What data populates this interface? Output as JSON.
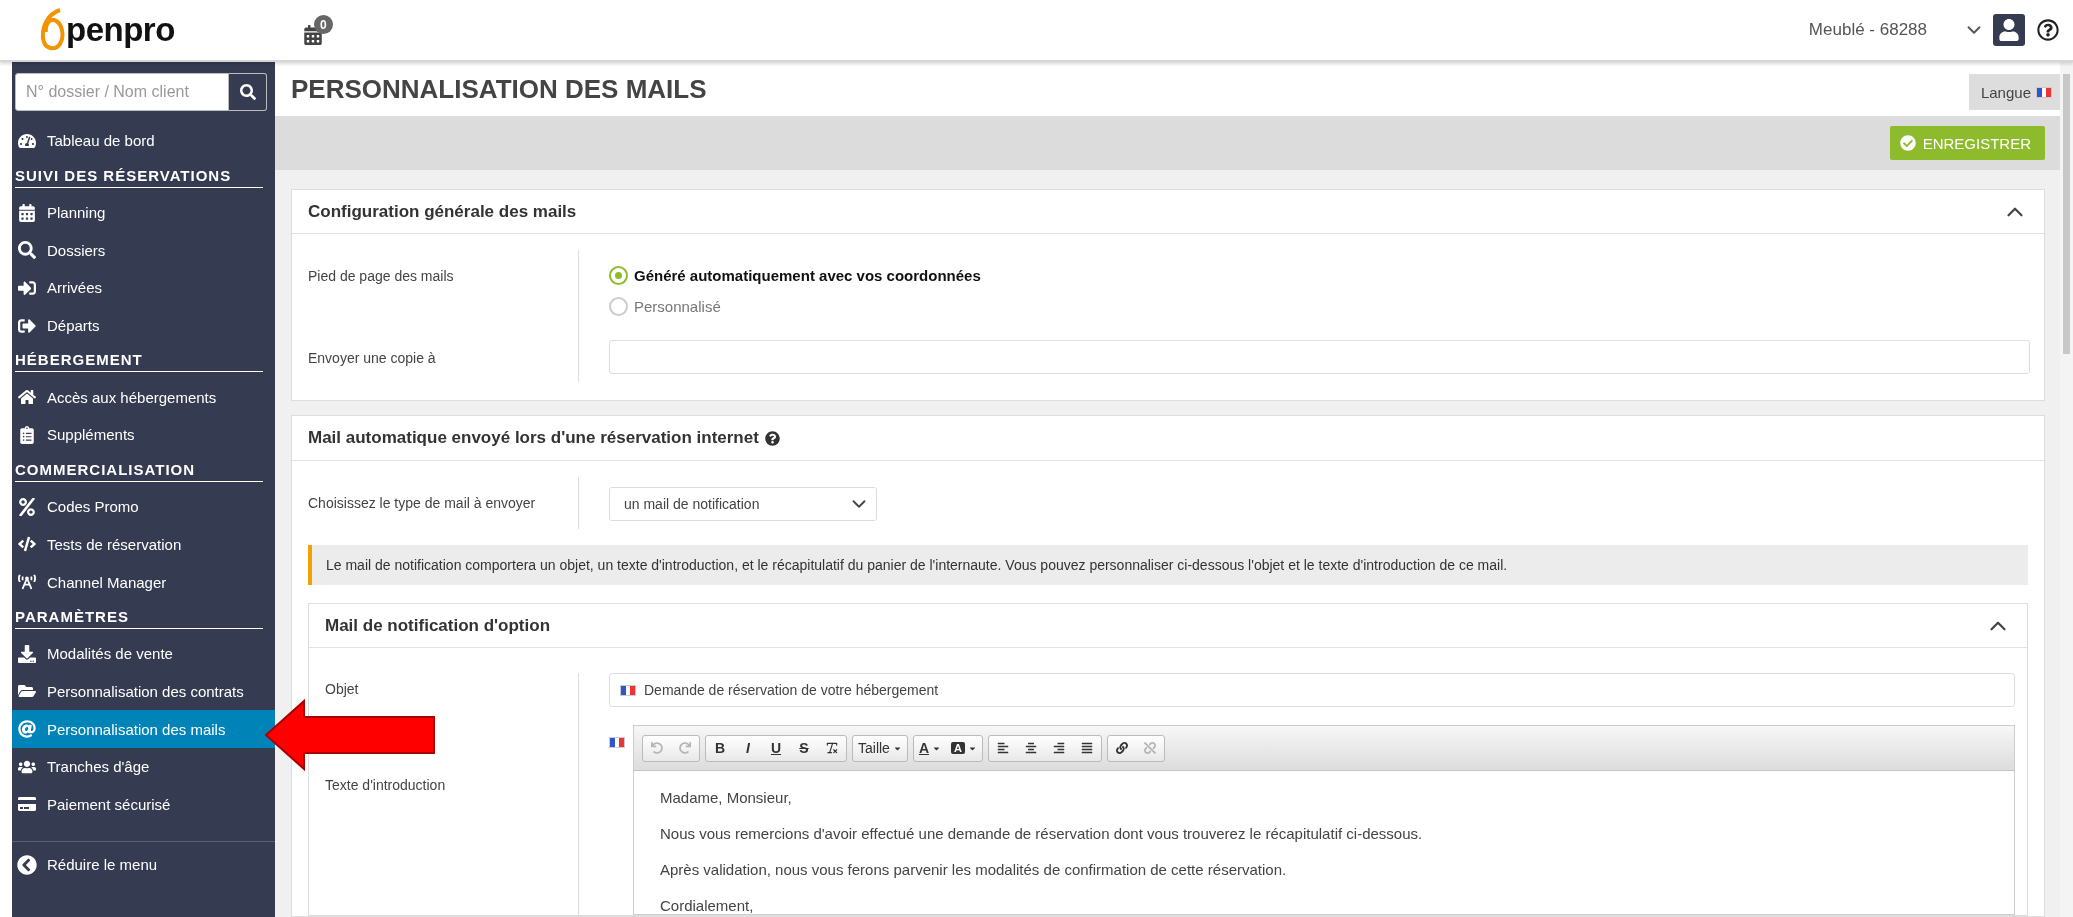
{
  "header": {
    "logo_text": "penpro",
    "notifications": "0",
    "account": "Meublé - 68288"
  },
  "sidebar": {
    "search": {
      "placeholder": "N° dossier / Nom client"
    },
    "items": [
      {
        "kind": "link",
        "label": "Tableau de bord",
        "selected": false
      },
      {
        "kind": "heading",
        "label": "SUIVI DES RÉSERVATIONS"
      },
      {
        "kind": "link",
        "label": "Planning",
        "selected": false
      },
      {
        "kind": "link",
        "label": "Dossiers",
        "selected": false
      },
      {
        "kind": "link",
        "label": "Arrivées",
        "selected": false
      },
      {
        "kind": "link",
        "label": "Départs",
        "selected": false
      },
      {
        "kind": "heading",
        "label": "HÉBERGEMENT"
      },
      {
        "kind": "link",
        "label": "Accès aux hébergements",
        "selected": false
      },
      {
        "kind": "link",
        "label": "Suppléments",
        "selected": false
      },
      {
        "kind": "heading",
        "label": "COMMERCIALISATION"
      },
      {
        "kind": "link",
        "label": "Codes Promo",
        "selected": false
      },
      {
        "kind": "link",
        "label": "Tests de réservation",
        "selected": false
      },
      {
        "kind": "link",
        "label": "Channel Manager",
        "selected": false
      },
      {
        "kind": "heading",
        "label": "PARAMÈTRES"
      },
      {
        "kind": "link",
        "label": "Modalités de vente",
        "selected": false
      },
      {
        "kind": "link",
        "label": "Personnalisation des contrats",
        "selected": false
      },
      {
        "kind": "link",
        "label": "Personnalisation des mails",
        "selected": true
      },
      {
        "kind": "link",
        "label": "Tranches d'âge",
        "selected": false
      },
      {
        "kind": "link",
        "label": "Paiement sécurisé",
        "selected": false
      }
    ],
    "collapse": "Réduire le menu"
  },
  "page": {
    "title": "PERSONNALISATION DES MAILS",
    "language_button": "Langue",
    "save_button": "ENREGISTRER"
  },
  "general_config": {
    "title": "Configuration générale des mails",
    "expanded": true,
    "footer": {
      "label": "Pied de page des mails",
      "options": [
        {
          "label": "Généré automatiquement avec vos coordonnées",
          "selected": true
        },
        {
          "label": "Personnalisé",
          "selected": false
        }
      ]
    },
    "copy": {
      "label": "Envoyer une copie à"
    }
  },
  "auto_mail": {
    "title": "Mail automatique envoyé lors d'une réservation internet",
    "type": {
      "label": "Choisissez le type de mail à envoyer",
      "value": "un mail de notification"
    },
    "notice": "Le mail de notification comportera un objet, un texte d'introduction, et le récapitulatif du panier de l'internaute. Vous pouvez personnaliser ci-dessous l'objet et le texte d'introduction de ce mail.",
    "notification": {
      "title": "Mail de notification d'option",
      "expanded": true,
      "subject": {
        "label": "Objet",
        "value": "Demande de réservation de votre hébergement"
      },
      "intro": {
        "label": "Texte d'introduction",
        "toolbar": [
          [
            {
              "kind": "undo",
              "disabled": true
            },
            {
              "kind": "redo",
              "disabled": true
            }
          ],
          [
            {
              "kind": "bold",
              "label": "B",
              "disabled": false
            },
            {
              "kind": "italic",
              "label": "I",
              "disabled": false
            },
            {
              "kind": "underline",
              "label": "U",
              "disabled": false
            },
            {
              "kind": "strike",
              "label": "S",
              "disabled": false
            },
            {
              "kind": "clear",
              "disabled": false
            }
          ],
          [
            {
              "kind": "dropdown",
              "label": "Taille",
              "disabled": false
            }
          ],
          [
            {
              "kind": "textcolor",
              "label": "A",
              "disabled": false
            },
            {
              "kind": "bgcolor",
              "label": "A",
              "disabled": false
            }
          ],
          [
            {
              "kind": "alignleft",
              "disabled": false
            },
            {
              "kind": "aligncenter",
              "disabled": false
            },
            {
              "kind": "alignright",
              "disabled": false
            },
            {
              "kind": "justify",
              "disabled": false
            }
          ],
          [
            {
              "kind": "link",
              "disabled": false
            },
            {
              "kind": "unlink",
              "disabled": true
            }
          ]
        ],
        "paragraphs": [
          "Madame, Monsieur,",
          "Nous vous remercions d'avoir effectué une demande de réservation dont vous trouverez le récapitulatif ci-dessous.",
          "Après validation, nous vous ferons parvenir les modalités de confirmation de cette réservation.",
          "Cordialement,"
        ]
      }
    }
  }
}
